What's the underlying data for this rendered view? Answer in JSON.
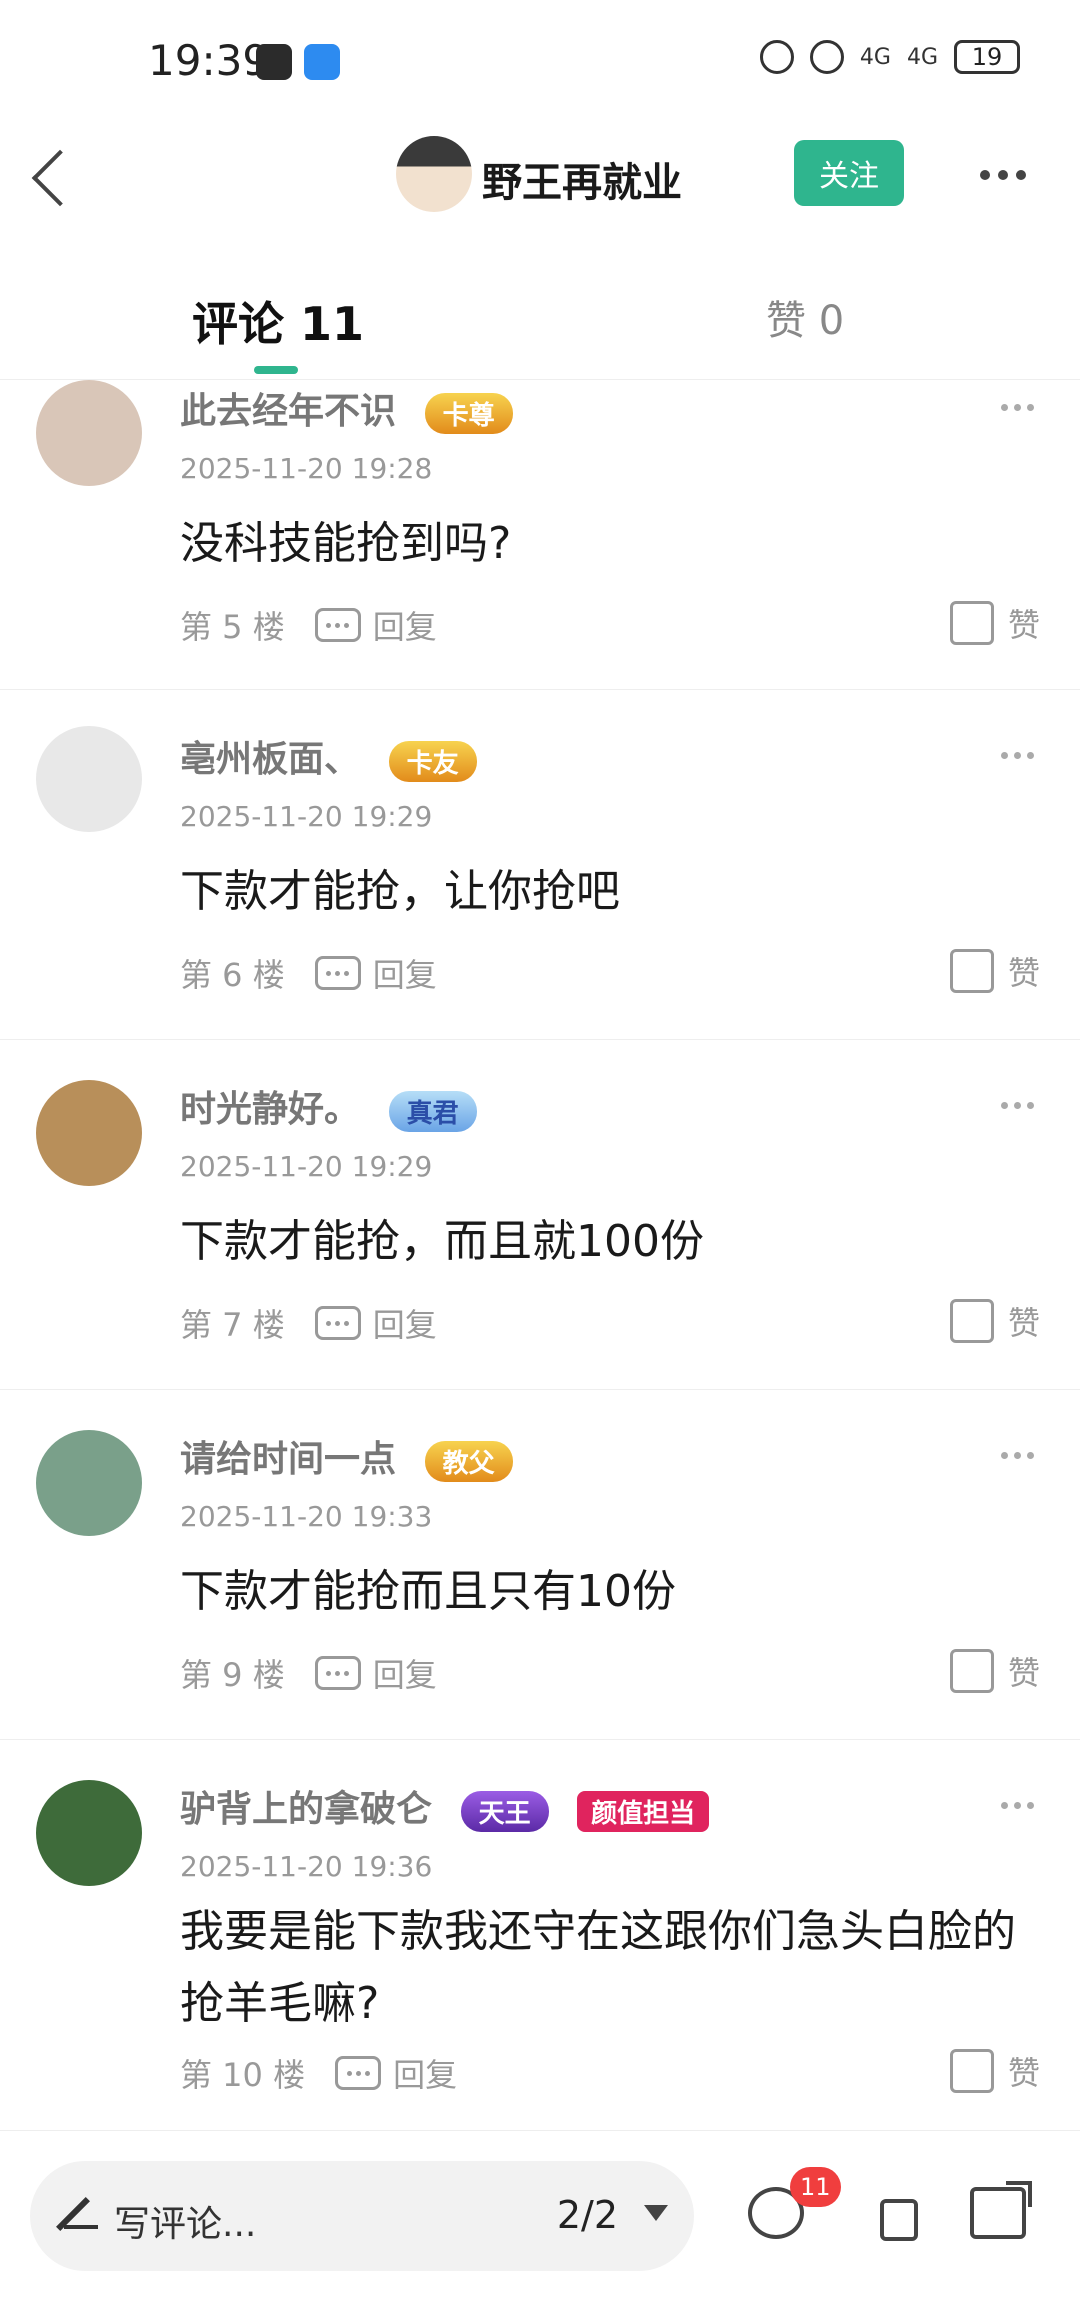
{
  "status": {
    "time": "19:39",
    "battery": "19",
    "signal": "4G"
  },
  "header": {
    "title": "野王再就业",
    "follow_label": "关注"
  },
  "tabs": [
    {
      "label": "评论 11",
      "active": true
    },
    {
      "label": "赞 0",
      "active": false
    }
  ],
  "comments": [
    {
      "name": "此去经年不识",
      "badge": "卡尊",
      "date": "2025-11-20 19:28",
      "text": "没科技能抢到吗?",
      "floor": "第 5 楼",
      "reply": "回复",
      "like": "赞"
    },
    {
      "name": "亳州板面、",
      "badge": "卡友",
      "date": "2025-11-20 19:29",
      "text": "下款才能抢，让你抢吧",
      "floor": "第 6 楼",
      "reply": "回复",
      "like": "赞"
    },
    {
      "name": "时光静好。",
      "badge": "真君",
      "date": "2025-11-20 19:29",
      "text": "下款才能抢，而且就100份",
      "floor": "第 7 楼",
      "reply": "回复",
      "like": "赞"
    },
    {
      "name": "请给时间一点",
      "badge": "教父",
      "date": "2025-11-20 19:33",
      "text": "下款才能抢而且只有10份",
      "floor": "第 9 楼",
      "reply": "回复",
      "like": "赞"
    },
    {
      "name": "驴背上的拿破仑",
      "badge": "天王",
      "badge2": "颜值担当",
      "date": "2025-11-20 19:36",
      "text": "我要是能下款我还守在这跟你们急头白脸的抢羊毛嘛?",
      "floor": "第 10 楼",
      "reply": "回复",
      "like": "赞"
    }
  ],
  "bottom": {
    "placeholder": "写评论...",
    "page": "2/2",
    "comment_count": "11"
  },
  "colors": {
    "accent": "#2fb58e",
    "badge_red": "#e0245e",
    "count_red": "#f03e3e"
  }
}
